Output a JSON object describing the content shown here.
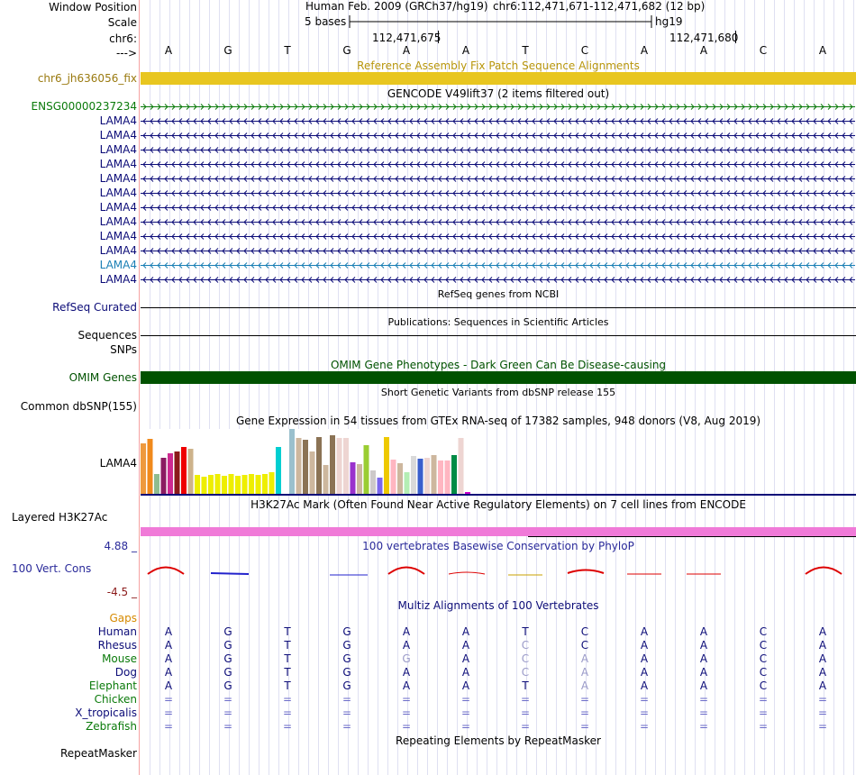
{
  "header": {
    "window_position_label": "Window Position",
    "scale_label": "Scale",
    "chrom_label": "chr6:",
    "strand_label": "--->",
    "assembly_text": "Human Feb. 2009 (GRCh37/hg19)",
    "position_text": "chr6:112,471,671-112,471,682 (12 bp)",
    "scale_text": "5 bases",
    "db_text": "hg19",
    "tick1": "112,471,675",
    "tick2": "112,471,680"
  },
  "sequence": [
    "A",
    "G",
    "T",
    "G",
    "A",
    "A",
    "T",
    "C",
    "A",
    "A",
    "C",
    "A"
  ],
  "tracks": {
    "fix_patch": {
      "label": "chr6_jh636056_fix",
      "title": "Reference Assembly Fix Patch Sequence Alignments",
      "color": "#e8c620"
    },
    "gencode": {
      "title": "GENCODE V49lift37 (2 items filtered out)",
      "items": [
        {
          "label": "ENSG00000237234",
          "color": "#0a7a0a",
          "direction": "forward"
        },
        {
          "label": "LAMA4",
          "color": "#0c0c78",
          "direction": "reverse"
        },
        {
          "label": "LAMA4",
          "color": "#0c0c78",
          "direction": "reverse"
        },
        {
          "label": "LAMA4",
          "color": "#0c0c78",
          "direction": "reverse"
        },
        {
          "label": "LAMA4",
          "color": "#0c0c78",
          "direction": "reverse"
        },
        {
          "label": "LAMA4",
          "color": "#0c0c78",
          "direction": "reverse"
        },
        {
          "label": "LAMA4",
          "color": "#0c0c78",
          "direction": "reverse"
        },
        {
          "label": "LAMA4",
          "color": "#0c0c78",
          "direction": "reverse"
        },
        {
          "label": "LAMA4",
          "color": "#0c0c78",
          "direction": "reverse"
        },
        {
          "label": "LAMA4",
          "color": "#0c0c78",
          "direction": "reverse"
        },
        {
          "label": "LAMA4",
          "color": "#0c0c78",
          "direction": "reverse"
        },
        {
          "label": "LAMA4",
          "color": "#1a7fb5",
          "direction": "reverse"
        },
        {
          "label": "LAMA4",
          "color": "#0c0c78",
          "direction": "reverse"
        }
      ]
    },
    "refseq": {
      "title": "RefSeq genes from NCBI",
      "label": "RefSeq Curated",
      "label_color": "#0c0c78"
    },
    "publications": {
      "title": "Publications: Sequences in Scientific Articles",
      "label": "Sequences"
    },
    "snps_label": "SNPs",
    "omim": {
      "title": "OMIM Gene Phenotypes - Dark Green Can Be Disease-causing",
      "label": "OMIM Genes",
      "color": "#005200",
      "label_color": "#005200"
    },
    "dbsnp": {
      "title": "Short Genetic Variants from dbSNP release 155",
      "label": "Common dbSNP(155)"
    },
    "gtex": {
      "title": "Gene Expression in 54 tissues from GTEx RNA-seq of 17382 samples, 948 donors (V8, Aug 2019)",
      "label": "LAMA4",
      "bars": [
        {
          "value": 0.78,
          "color": "#ee9a3e"
        },
        {
          "value": 0.85,
          "color": "#f08a1c"
        },
        {
          "value": 0.31,
          "color": "#8fbc8f"
        },
        {
          "value": 0.55,
          "color": "#8b1c62"
        },
        {
          "value": 0.62,
          "color": "#cd2990"
        },
        {
          "value": 0.65,
          "color": "#8b1a1a"
        },
        {
          "value": 0.72,
          "color": "#ee0000"
        },
        {
          "value": 0.69,
          "color": "#cdb38b"
        },
        {
          "value": 0.29,
          "color": "#eeee00"
        },
        {
          "value": 0.27,
          "color": "#eeee00"
        },
        {
          "value": 0.29,
          "color": "#eeee00"
        },
        {
          "value": 0.31,
          "color": "#eeee00"
        },
        {
          "value": 0.28,
          "color": "#eeee00"
        },
        {
          "value": 0.3,
          "color": "#eeee00"
        },
        {
          "value": 0.28,
          "color": "#eeee00"
        },
        {
          "value": 0.29,
          "color": "#eeee00"
        },
        {
          "value": 0.31,
          "color": "#eeee00"
        },
        {
          "value": 0.29,
          "color": "#eeee00"
        },
        {
          "value": 0.31,
          "color": "#eeee00"
        },
        {
          "value": 0.33,
          "color": "#eeee00"
        },
        {
          "value": 0.72,
          "color": "#00ced1"
        },
        {
          "value": 0.57,
          "color": "#ffffff"
        },
        {
          "value": 1.0,
          "color": "#9ac0cd"
        },
        {
          "value": 0.86,
          "color": "#cdb79e"
        },
        {
          "value": 0.83,
          "color": "#8b7355"
        },
        {
          "value": 0.65,
          "color": "#cdb79e"
        },
        {
          "value": 0.88,
          "color": "#8b7355"
        },
        {
          "value": 0.44,
          "color": "#cdb79e"
        },
        {
          "value": 0.9,
          "color": "#8b7355"
        },
        {
          "value": 0.86,
          "color": "#eed5d2"
        },
        {
          "value": 0.86,
          "color": "#eed5d2"
        },
        {
          "value": 0.49,
          "color": "#9a32cd"
        },
        {
          "value": 0.46,
          "color": "#cdb79e"
        },
        {
          "value": 0.75,
          "color": "#9acd32"
        },
        {
          "value": 0.36,
          "color": "#cdc9c9"
        },
        {
          "value": 0.25,
          "color": "#7a67ee"
        },
        {
          "value": 0.88,
          "color": "#eec900"
        },
        {
          "value": 0.53,
          "color": "#ffb6c1"
        },
        {
          "value": 0.47,
          "color": "#cdb79e"
        },
        {
          "value": 0.33,
          "color": "#b4eeb4"
        },
        {
          "value": 0.59,
          "color": "#d9d9d9"
        },
        {
          "value": 0.54,
          "color": "#3a5fcd"
        },
        {
          "value": 0.56,
          "color": "#eed5d2"
        },
        {
          "value": 0.6,
          "color": "#cdb79e"
        },
        {
          "value": 0.51,
          "color": "#ffb6c1"
        },
        {
          "value": 0.51,
          "color": "#ffb6c1"
        },
        {
          "value": 0.6,
          "color": "#008b45"
        },
        {
          "value": 0.86,
          "color": "#eed5d2"
        },
        {
          "value": 0.03,
          "color": "#cd00cd"
        }
      ]
    },
    "h3k27ac": {
      "title": "H3K27Ac Mark (Often Found Near Active Regulatory Elements) on 7 cell lines from ENCODE",
      "label": "Layered H3K27Ac",
      "color": "#f07ad8"
    },
    "phylop": {
      "title": "100 vertebrates Basewise Conservation by PhyloP",
      "label": "100 Vert. Cons",
      "max_label": "4.88 _",
      "min_label": "-4.5 _",
      "title_color": "#2a2a9a",
      "max_color": "#2a2a9a",
      "min_color": "#8b1a1a"
    },
    "multiz": {
      "title": "Multiz Alignments of 100 Vertebrates",
      "title_color": "#0c0c78",
      "gaps_label": "Gaps",
      "gaps_color": "#d68a00",
      "species": [
        {
          "name": "Human",
          "color": "#0c0c78",
          "bases": [
            "A",
            "G",
            "T",
            "G",
            "A",
            "A",
            "T",
            "C",
            "A",
            "A",
            "C",
            "A"
          ]
        },
        {
          "name": "Rhesus",
          "color": "#0c0c78",
          "bases": [
            "A",
            "G",
            "T",
            "G",
            "A",
            "A",
            "C",
            "C",
            "A",
            "A",
            "C",
            "A"
          ]
        },
        {
          "name": "Mouse",
          "color": "#0a7a0a",
          "bases": [
            "A",
            "G",
            "T",
            "G",
            "G",
            "A",
            "C",
            "A",
            "A",
            "A",
            "C",
            "A"
          ]
        },
        {
          "name": "Dog",
          "color": "#0c0c78",
          "bases": [
            "A",
            "G",
            "T",
            "G",
            "A",
            "A",
            "C",
            "A",
            "A",
            "A",
            "C",
            "A"
          ]
        },
        {
          "name": "Elephant",
          "color": "#0a7a0a",
          "bases": [
            "A",
            "G",
            "T",
            "G",
            "A",
            "A",
            "T",
            "A",
            "A",
            "A",
            "C",
            "A"
          ]
        },
        {
          "name": "Chicken",
          "color": "#0a7a0a",
          "bases": [
            "=",
            "=",
            "=",
            "=",
            "=",
            "=",
            "=",
            "=",
            "=",
            "=",
            "=",
            "="
          ]
        },
        {
          "name": "X_tropicalis",
          "color": "#0c0c78",
          "bases": [
            "=",
            "=",
            "=",
            "=",
            "=",
            "=",
            "=",
            "=",
            "=",
            "=",
            "=",
            "="
          ]
        },
        {
          "name": "Zebrafish",
          "color": "#0a7a0a",
          "bases": [
            "=",
            "=",
            "=",
            "=",
            "=",
            "=",
            "=",
            "=",
            "=",
            "=",
            "=",
            "="
          ]
        }
      ]
    },
    "repeatmasker": {
      "title": "Repeating Elements by RepeatMasker",
      "label": "RepeatMasker"
    }
  }
}
